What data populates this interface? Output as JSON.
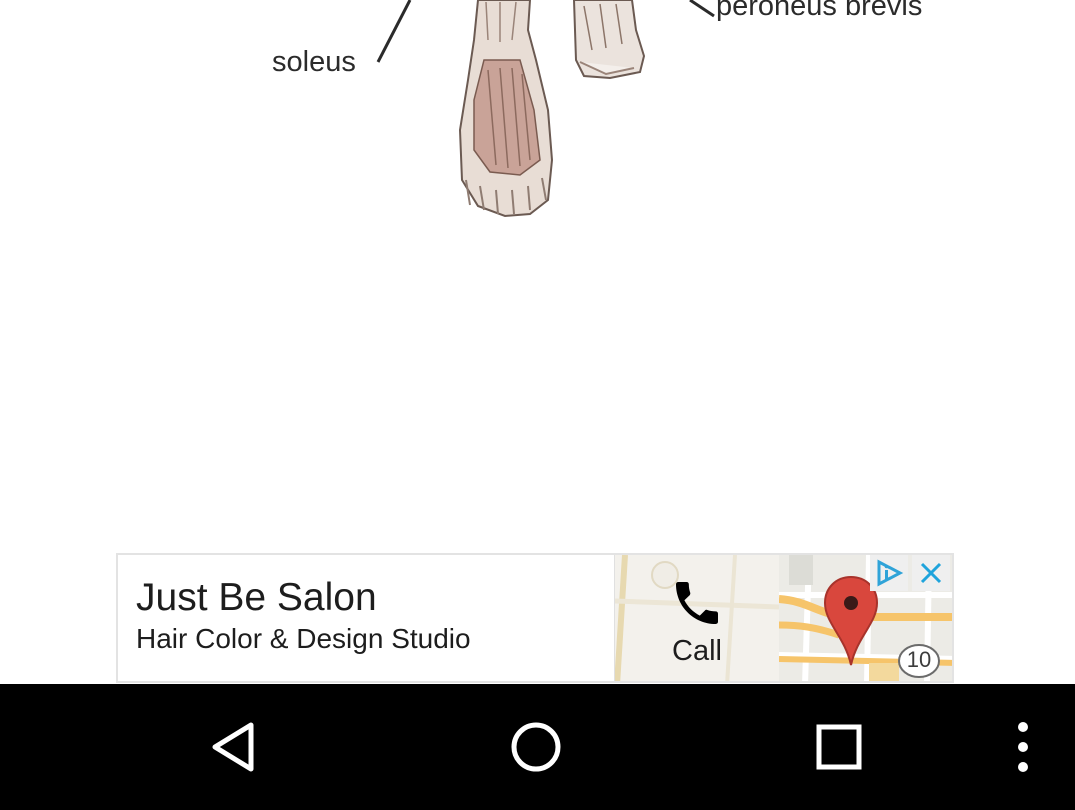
{
  "figure": {
    "labels": {
      "soleus": "soleus",
      "peroneus_brevis": "peroneus brevis"
    }
  },
  "ad": {
    "title": "Just Be Salon",
    "subtitle": "Hair Color & Design Studio",
    "call_label": "Call",
    "map_route_number": "10",
    "icons": [
      "phone-icon",
      "map-pin-icon",
      "ad-choices-icon",
      "close-icon"
    ],
    "colors": {
      "pin": "#d9473d",
      "choices": "#2fa3d8",
      "close": "#1fa4dc"
    }
  },
  "navbar": {
    "buttons": [
      "back-icon",
      "home-icon",
      "recents-icon",
      "menu-icon"
    ]
  }
}
